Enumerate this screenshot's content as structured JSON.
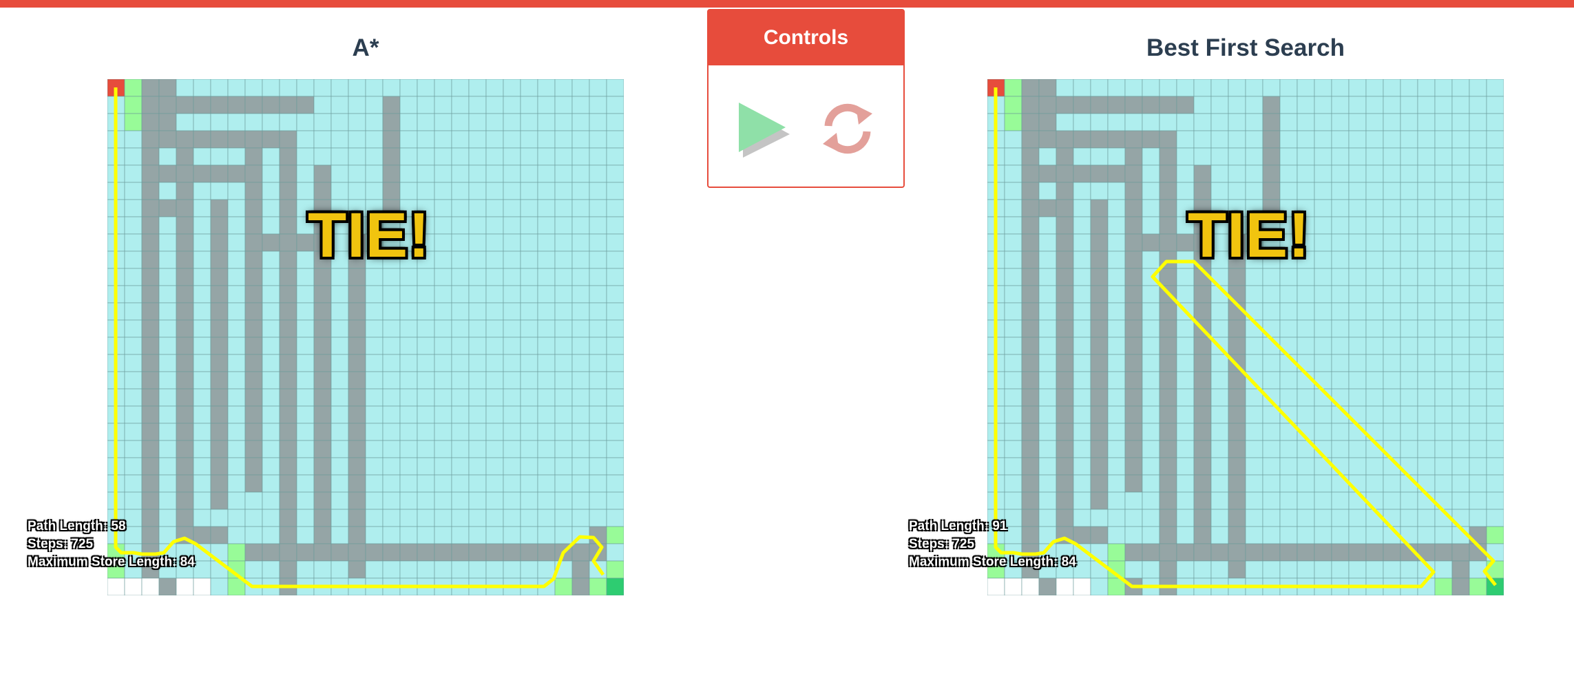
{
  "colors": {
    "accent": "#e74c3c",
    "open": "#afeeee",
    "wall": "#95a5a6",
    "frontier": "#98fb98",
    "start": "#e74c3c",
    "goal": "#2ecc71",
    "unvisited": "#ffffff",
    "path": "#ffff00",
    "tie": "#f1c40f"
  },
  "controls": {
    "title": "Controls",
    "play_icon": "play-icon",
    "reset_icon": "reset-icon"
  },
  "panels": [
    {
      "title": "A*",
      "result": "TIE!",
      "stats": {
        "path_length": "Path Length: 58",
        "steps": "Steps: 725",
        "max_store": "Maximum Store Length: 84"
      }
    },
    {
      "title": "Best First Search",
      "result": "TIE!",
      "stats": {
        "path_length": "Path Length: 91",
        "steps": "Steps: 725",
        "max_store": "Maximum Store Length: 84"
      }
    }
  ]
}
